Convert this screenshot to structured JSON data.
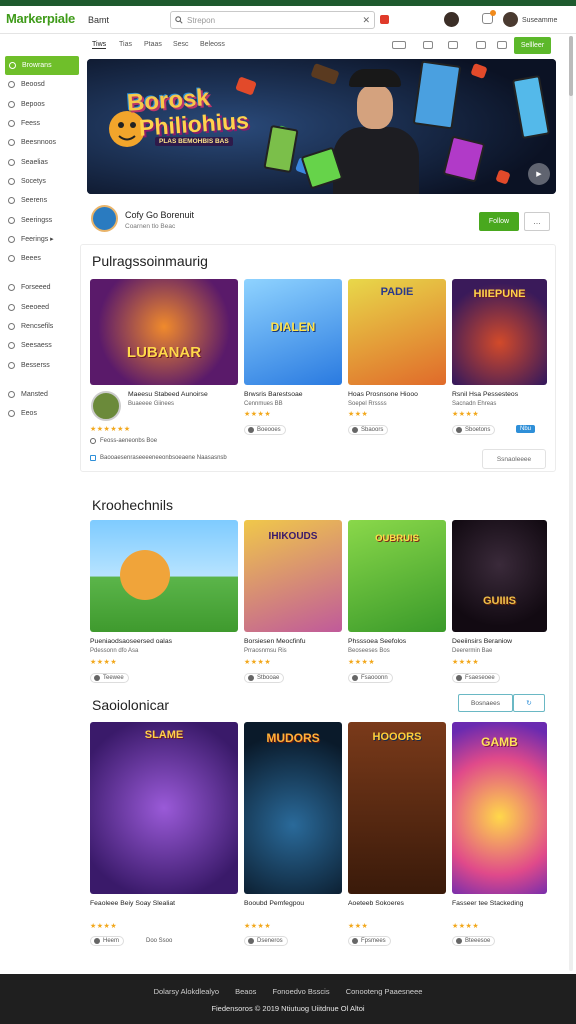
{
  "header": {
    "logo": "Markerpiale",
    "store_label": "Bamt",
    "search_placeholder": "Strepon",
    "user_name": "Suseamme",
    "menu_label": "☰"
  },
  "subnav": {
    "items": [
      "Tiws",
      "Tias",
      "Ptaas",
      "Sesc",
      "Beleoss"
    ],
    "sell_button": "Sellleer"
  },
  "sidebar": {
    "items": [
      {
        "label": "Browrans",
        "active": true
      },
      {
        "label": "Beoosd",
        "active": false
      },
      {
        "label": "Bepoos",
        "active": false
      },
      {
        "label": "Feess",
        "active": false
      },
      {
        "label": "Beesnnoos",
        "active": false
      },
      {
        "label": "Seaelias",
        "active": false
      },
      {
        "label": "Socetys",
        "active": false
      },
      {
        "label": "Seerens",
        "active": false
      },
      {
        "label": "Seeringss",
        "active": false
      },
      {
        "label": "Feerings ▸",
        "active": false
      },
      {
        "label": "Beees",
        "active": false
      },
      {
        "label": "Forseeed",
        "active": false
      },
      {
        "label": "Seeoeed",
        "active": false
      },
      {
        "label": "Rencsefils",
        "active": false
      },
      {
        "label": "Seesaess",
        "active": false
      },
      {
        "label": "Besserss",
        "active": false
      },
      {
        "label": "Mansted",
        "active": false
      },
      {
        "label": "Eeos",
        "active": false
      }
    ]
  },
  "hero": {
    "title_line1": "Borosk",
    "title_line2": "Philiohius",
    "subtitle": "PLAS BEMOHBIS BAS",
    "play_label": "▶"
  },
  "profile": {
    "name": "Cofy Go Borenuit",
    "sub": "Coarnen tlo Beac",
    "follow_label": "Follow",
    "more_label": "…"
  },
  "sections": [
    {
      "title": "Pulragssoinmaurig",
      "cards": [
        {
          "thumb_title": "LUBANAR",
          "title": "Maeesu Stabeed Aunoirse",
          "sub": "Buaeeee Giinees",
          "stars": "★★★★★★",
          "chip": "Boooos, hs"
        },
        {
          "thumb_title": "DIALEN",
          "title": "Brwsris Barestsoae",
          "sub": "Cennmues BB",
          "stars": "★★★★",
          "chip": "Boeooes"
        },
        {
          "thumb_title": "PADIE",
          "title": "Hoas Prosnsone Hiooo",
          "sub": "Soepel Rrssss",
          "stars": "★★★",
          "chip": "Sbaoors"
        },
        {
          "thumb_title": "HIIEPUNE",
          "title": "Rsnil Hsa Pessesteos",
          "sub": "Sacnadn Ehreas",
          "stars": "★★★★",
          "chip": "Sboetons",
          "tag": "Nbu"
        }
      ],
      "row1": "Feoss-aeneonbs Boe",
      "row2": "Baooaesenraseeeeneeonbsoeaene Naasasnsb",
      "view_all": "Ssnaoleeee"
    },
    {
      "title": "Kroohechnils",
      "cards": [
        {
          "thumb_title": "",
          "title": "Pueniaodsaoseersed oalas",
          "sub": "Pdessonn dfo Asa",
          "stars": "★★★★",
          "chip": "Teewee"
        },
        {
          "thumb_title": "IHIKOUDS",
          "title": "Borsiesen Meocfinfu",
          "sub": "Prraosnmsu Ris",
          "stars": "★★★★",
          "chip": "Stbooae"
        },
        {
          "thumb_title": "OUBRUIS",
          "title": "Phsssoea Seefolos",
          "sub": "Beoseeses Bos",
          "stars": "★★★★",
          "chip": "Fsaooonn"
        },
        {
          "thumb_title": "GUIIIS",
          "title": "Deeiinsirs Beraniow",
          "sub": "Deerermin Bae",
          "stars": "★★★★",
          "chip": "Fsaeseoee"
        }
      ]
    },
    {
      "title": "Saoiolonicar",
      "seg_left": "Bosnaees",
      "seg_right": "↻",
      "cards": [
        {
          "thumb_title": "SLAME",
          "title": "Feaoleee Beiy Soay Slealiat",
          "sub": "",
          "stars": "★★★★",
          "chip": "Heem",
          "chip2": "Doo Ssoo"
        },
        {
          "thumb_title": "MUDORS",
          "title": "Booubd Pemfegpou",
          "sub": "",
          "stars": "★★★★",
          "chip": "Dseneros"
        },
        {
          "thumb_title": "HOOORS",
          "title": "Aoeteeb Sokoeres",
          "sub": "",
          "stars": "★★★",
          "chip": "Fpsmees"
        },
        {
          "thumb_title": "GAMB",
          "title": "Fasseer tee Stackeding",
          "sub": "",
          "stars": "★★★★",
          "chip": "Bteeesoe"
        }
      ]
    }
  ],
  "footer": {
    "links": [
      "Dolarsy Alokdlealyo",
      "Beaos",
      "Fonoedvo Bsscis",
      "Conooteng Paaesneee"
    ],
    "copyright": "Fiedensoros © 2019 Ntiutuog Uiitdnue Ol Altoi"
  },
  "colors": {
    "accent": "#5cb82a",
    "top_strip": "#1e5a2e",
    "footer_bg": "#1f1f1f",
    "info_tag": "#2e8fd8",
    "star": "#f2a81d"
  }
}
